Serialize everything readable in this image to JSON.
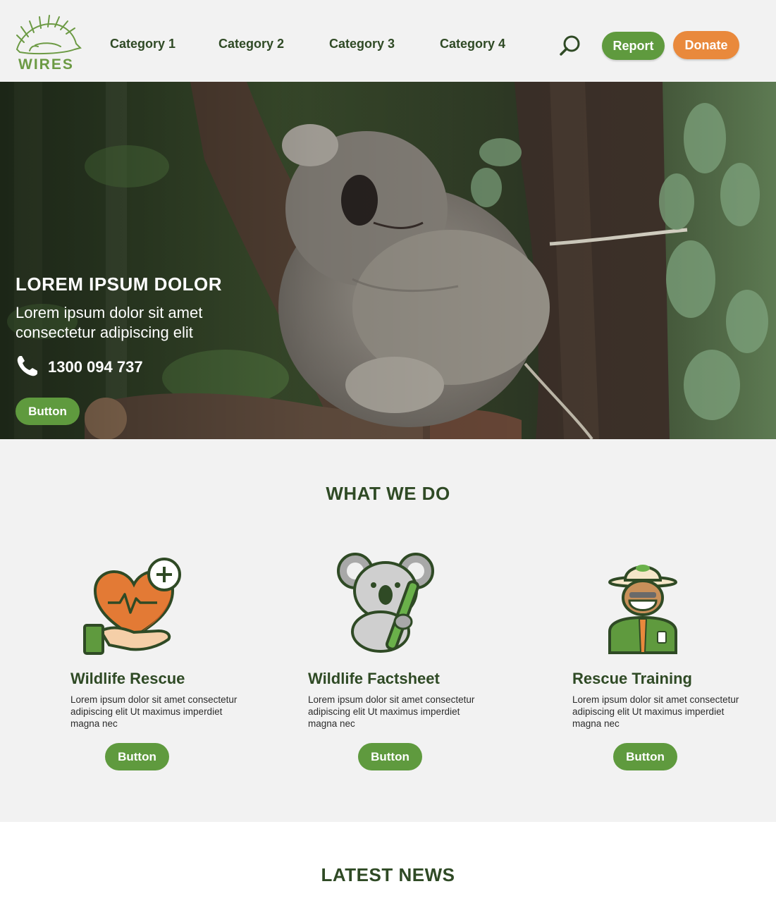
{
  "header": {
    "logo_text": "WIRES",
    "nav": [
      "Category 1",
      "Category 2",
      "Category 3",
      "Category 4"
    ],
    "search_icon": "search-icon",
    "report_label": "Report",
    "donate_label": "Donate",
    "colors": {
      "primary_green": "#5f9a3e",
      "dark_green": "#2f4a25",
      "orange": "#e9893c"
    }
  },
  "hero": {
    "title": "LOREM IPSUM DOLOR",
    "subtitle": "Lorem ipsum dolor sit amet consectetur adipiscing elit",
    "phone_icon": "phone-icon",
    "phone": "1300 094 737",
    "button_label": "Button"
  },
  "what_we_do": {
    "title": "WHAT WE DO",
    "cards": [
      {
        "icon": "heart-hand-icon",
        "title": "Wildlife Rescue",
        "description": "Lorem ipsum dolor sit amet consectetur adipiscing elit Ut maximus imperdiet magna nec",
        "button_label": "Button"
      },
      {
        "icon": "koala-icon",
        "title": "Wildlife Factsheet",
        "description": "Lorem ipsum dolor sit amet consectetur adipiscing elit Ut maximus imperdiet magna nec",
        "button_label": "Button"
      },
      {
        "icon": "ranger-icon",
        "title": "Rescue Training",
        "description": "Lorem ipsum dolor sit amet consectetur adipiscing elit Ut maximus imperdiet magna nec",
        "button_label": "Button"
      }
    ]
  },
  "latest_news": {
    "title": "LATEST NEWS"
  }
}
